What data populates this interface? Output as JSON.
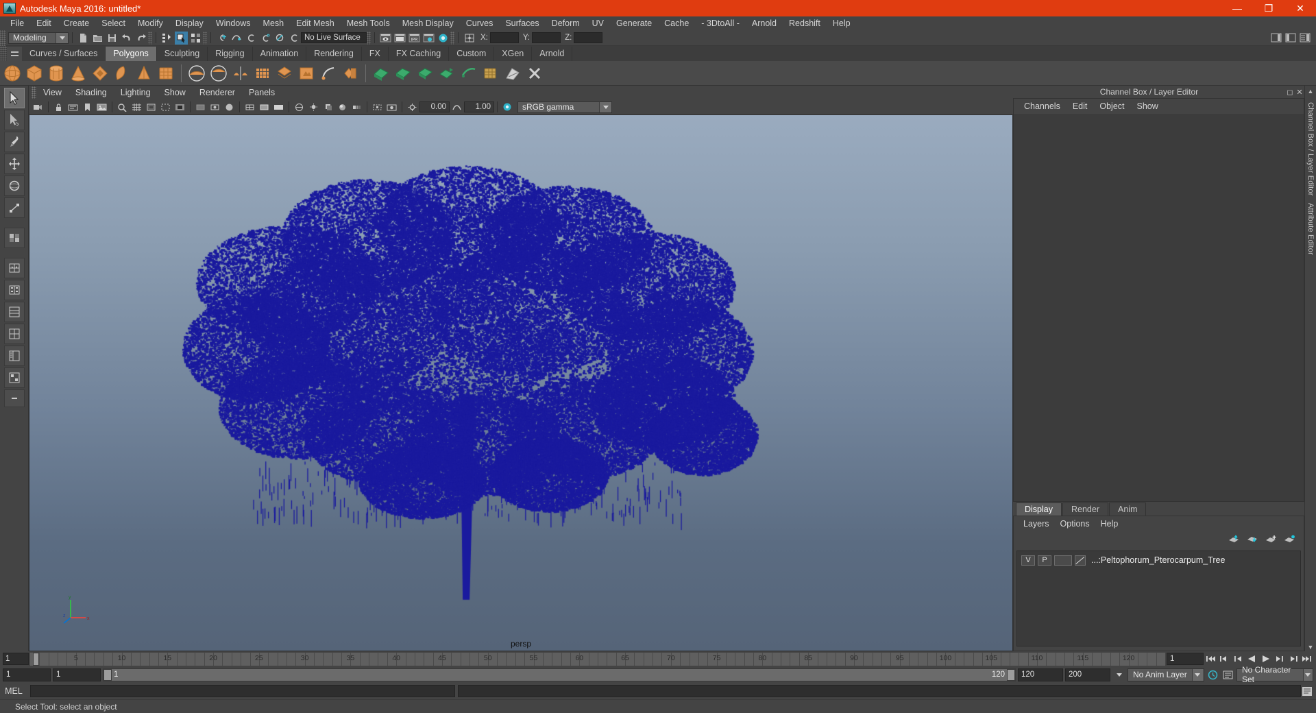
{
  "window": {
    "title": "Autodesk Maya 2016: untitled*",
    "logo_icon": "maya-logo-icon",
    "minimize": "—",
    "maximize": "❐",
    "close": "✕",
    "accent": "#e03c10"
  },
  "menubar": {
    "items": [
      "File",
      "Edit",
      "Create",
      "Select",
      "Modify",
      "Display",
      "Windows",
      "Mesh",
      "Edit Mesh",
      "Mesh Tools",
      "Mesh Display",
      "Curves",
      "Surfaces",
      "Deform",
      "UV",
      "Generate",
      "Cache",
      "- 3DtoAll -",
      "Arnold",
      "Redshift",
      "Help"
    ]
  },
  "statusline": {
    "mode": "Modeling",
    "live_surface": "No Live Surface",
    "x_label": "X:",
    "y_label": "Y:",
    "z_label": "Z:",
    "x_value": "",
    "y_value": "",
    "z_value": "",
    "ipr_label": "IPR",
    "icons": [
      "new-scene-icon",
      "open-scene-icon",
      "save-scene-icon",
      "undo-icon",
      "redo-icon",
      "select-by-hierarchy-icon",
      "select-by-object-icon",
      "select-by-component-icon",
      "snap-to-grid-icon",
      "snap-to-curve-icon",
      "snap-to-point-icon",
      "snap-to-projected-center-icon",
      "snap-to-view-plane-icon",
      "make-live-icon",
      "render-view-icon",
      "render-current-frame-icon",
      "ipr-render-icon",
      "render-settings-icon",
      "hypershade-icon",
      "editor-toggle-icon"
    ],
    "right_icons": [
      "show-hide-attribute-editor-icon",
      "show-hide-tool-settings-icon",
      "show-hide-channel-box-icon"
    ]
  },
  "shelf": {
    "tabs": [
      "Curves / Surfaces",
      "Polygons",
      "Sculpting",
      "Rigging",
      "Animation",
      "Rendering",
      "FX",
      "FX Caching",
      "Custom",
      "XGen",
      "Arnold"
    ],
    "active_tab": "Polygons",
    "icons": [
      "poly-sphere-icon",
      "poly-cube-icon",
      "poly-cylinder-icon",
      "poly-cone-icon",
      "poly-torus-icon",
      "poly-plane-icon",
      "poly-pyramid-icon",
      "poly-prism-icon",
      "poly-pipe-icon",
      "poly-helix-icon",
      "poly-soccer-ball-icon",
      "poly-platonic-icon",
      "poly-type-icon",
      "poly-svg-icon",
      "poly-sweep-icon",
      "poly-combine-icon",
      "poly-separate-icon",
      "poly-booleans-icon",
      "poly-smooth-icon",
      "poly-extrude-icon",
      "poly-bevel-icon",
      "poly-bridge-icon",
      "poly-append-icon",
      "poly-wedge-icon",
      "poly-mirror-icon",
      "poly-duplicate-icon",
      "poly-connect-icon",
      "poly-multi-cut-icon",
      "poly-target-weld-icon",
      "poly-paint-select-icon",
      "poly-transform-icon",
      "poly-delete-icon"
    ]
  },
  "toolbox": {
    "tools": [
      {
        "name": "select-tool",
        "icon": "arrow-cursor-icon",
        "active": true
      },
      {
        "name": "lasso-tool",
        "icon": "lasso-icon",
        "active": false
      },
      {
        "name": "paint-select-tool",
        "icon": "paint-brush-icon",
        "active": false
      },
      {
        "name": "move-tool",
        "icon": "move-arrows-icon",
        "active": false
      },
      {
        "name": "rotate-tool",
        "icon": "rotate-circle-icon",
        "active": false
      },
      {
        "name": "scale-tool",
        "icon": "scale-box-icon",
        "active": false
      },
      {
        "name": "last-tool",
        "icon": "last-tool-icon",
        "active": false
      },
      {
        "name": "single-pane-layout",
        "icon": "single-pane-icon",
        "active": false
      },
      {
        "name": "two-pane-side-layout",
        "icon": "two-pane-side-icon",
        "active": false
      },
      {
        "name": "two-pane-stacked-layout",
        "icon": "two-pane-stacked-icon",
        "active": false
      },
      {
        "name": "four-pane-layout",
        "icon": "four-pane-icon",
        "active": false
      },
      {
        "name": "persp-outliner-layout",
        "icon": "persp-outliner-icon",
        "active": false
      },
      {
        "name": "hypershade-layout",
        "icon": "hypershade-layout-icon",
        "active": false
      },
      {
        "name": "more-layouts",
        "icon": "ellipsis-icon",
        "active": false
      }
    ]
  },
  "viewport": {
    "menus": [
      "View",
      "Shading",
      "Lighting",
      "Show",
      "Renderer",
      "Panels"
    ],
    "camera_label": "persp",
    "exposure_value": "0.00",
    "gamma_value": "1.00",
    "color_space": "sRGB gamma",
    "axis_labels": {
      "x": "x",
      "y": "y",
      "z": "z"
    },
    "bg_top": "#9aabbf",
    "bg_bottom": "#556478",
    "object_color": "#1a1a9e",
    "toolbar_icons": [
      "select-camera-icon",
      "lock-camera-icon",
      "camera-attributes-icon",
      "bookmark-icon",
      "image-plane-icon",
      "two-d-pan-zoom-icon",
      "grid-toggle-icon",
      "film-gate-icon",
      "resolution-gate-icon",
      "gate-mask-icon",
      "xray-icon",
      "xray-joints-icon",
      "shaded-icon",
      "wireframe-icon",
      "wireframe-on-shaded-icon",
      "smooth-shade-icon",
      "texture-toggle-icon",
      "lights-toggle-icon",
      "shadows-toggle-icon",
      "screen-space-ao-icon",
      "motion-blur-icon",
      "multisample-icon",
      "depth-of-field-icon",
      "isolate-select-icon",
      "snapshot-icon",
      "exposure-icon",
      "gamma-icon",
      "color-management-icon"
    ]
  },
  "channel_box": {
    "panel_title": "Channel Box / Layer Editor",
    "menus": [
      "Channels",
      "Edit",
      "Object",
      "Show"
    ],
    "header_icons": [
      "channel-box-icon",
      "attribute-editor-icon"
    ]
  },
  "layer_editor": {
    "tabs": [
      "Display",
      "Render",
      "Anim"
    ],
    "active_tab": "Display",
    "menus": [
      "Layers",
      "Options",
      "Help"
    ],
    "action_icons": [
      "move-layer-up-icon",
      "move-layer-down-icon",
      "create-new-layer-icon",
      "create-layer-from-selected-icon"
    ],
    "layers": [
      {
        "visibility": "V",
        "playback": "P",
        "shading": "",
        "color_icon": "layer-color-icon",
        "name": "...:Peltophorum_Pterocarpum_Tree"
      }
    ]
  },
  "dock_strip": {
    "labels": [
      "Channel Box / Layer Editor",
      "Attribute Editor"
    ]
  },
  "timeline": {
    "start_field": "1",
    "ticks": [
      5,
      10,
      15,
      20,
      25,
      30,
      35,
      40,
      45,
      50,
      55,
      60,
      65,
      70,
      75,
      80,
      85,
      90,
      95,
      100,
      105,
      110,
      115,
      120
    ],
    "current_frame": "1",
    "current_frame_field": "1",
    "playback_icons": [
      "go-to-start-icon",
      "step-back-key-icon",
      "step-back-frame-icon",
      "play-backwards-icon",
      "play-forwards-icon",
      "step-forward-frame-icon",
      "step-forward-key-icon",
      "go-to-end-icon"
    ]
  },
  "range_slider": {
    "anim_start": "1",
    "range_start": "1",
    "bar_start_label": "1",
    "bar_end_label": "120",
    "range_end": "120",
    "anim_end": "200",
    "anim_layer": "No Anim Layer",
    "character_set": "No Character Set",
    "auto_key_icon": "auto-keyframe-icon",
    "prefs_icon": "animation-preferences-icon"
  },
  "command_line": {
    "label": "MEL",
    "input_value": "",
    "output_value": "",
    "script_editor_icon": "script-editor-icon"
  },
  "status_bar": {
    "message": "Select Tool: select an object"
  }
}
